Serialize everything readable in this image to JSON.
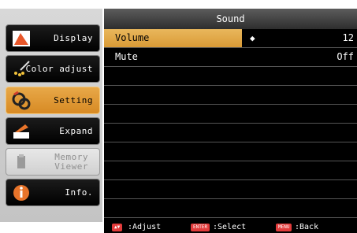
{
  "sidebar": {
    "items": [
      {
        "label": "Display",
        "icon": "display-icon"
      },
      {
        "label": "Color adjust",
        "icon": "color-adjust-icon"
      },
      {
        "label": "Setting",
        "icon": "setting-icon",
        "active": true
      },
      {
        "label": "Expand",
        "icon": "expand-icon"
      },
      {
        "label_line1": "Memory",
        "label_line2": "Viewer",
        "icon": "memory-viewer-icon",
        "disabled": true
      },
      {
        "label": "Info.",
        "icon": "info-icon"
      }
    ]
  },
  "panel": {
    "title": "Sound",
    "rows": [
      {
        "name": "Volume",
        "value": "12",
        "adjust_glyph": "◆"
      },
      {
        "name": "Mute",
        "value": "Off"
      }
    ]
  },
  "footer": {
    "adjust_key": "▲▼",
    "adjust_label": ":Adjust",
    "select_key": "ENTER",
    "select_label": ":Select",
    "back_key": "MENU",
    "back_label": ":Back"
  },
  "colors": {
    "accent": "#d99a36",
    "panel_bg": "#000000",
    "footer_key": "#e23b3b"
  }
}
